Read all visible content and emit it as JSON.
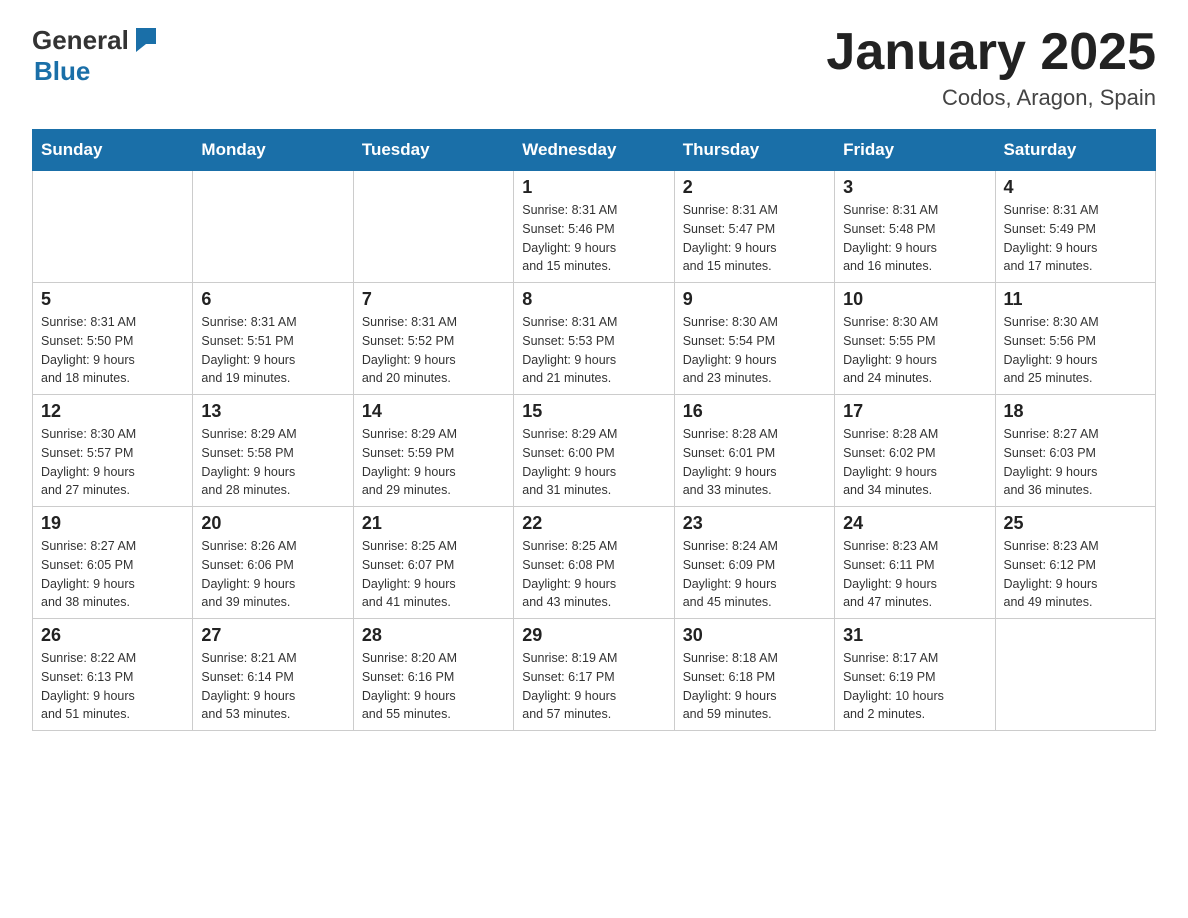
{
  "header": {
    "logo_general": "General",
    "logo_blue": "Blue",
    "title": "January 2025",
    "subtitle": "Codos, Aragon, Spain"
  },
  "days_of_week": [
    "Sunday",
    "Monday",
    "Tuesday",
    "Wednesday",
    "Thursday",
    "Friday",
    "Saturday"
  ],
  "weeks": [
    [
      {
        "day": "",
        "info": ""
      },
      {
        "day": "",
        "info": ""
      },
      {
        "day": "",
        "info": ""
      },
      {
        "day": "1",
        "info": "Sunrise: 8:31 AM\nSunset: 5:46 PM\nDaylight: 9 hours\nand 15 minutes."
      },
      {
        "day": "2",
        "info": "Sunrise: 8:31 AM\nSunset: 5:47 PM\nDaylight: 9 hours\nand 15 minutes."
      },
      {
        "day": "3",
        "info": "Sunrise: 8:31 AM\nSunset: 5:48 PM\nDaylight: 9 hours\nand 16 minutes."
      },
      {
        "day": "4",
        "info": "Sunrise: 8:31 AM\nSunset: 5:49 PM\nDaylight: 9 hours\nand 17 minutes."
      }
    ],
    [
      {
        "day": "5",
        "info": "Sunrise: 8:31 AM\nSunset: 5:50 PM\nDaylight: 9 hours\nand 18 minutes."
      },
      {
        "day": "6",
        "info": "Sunrise: 8:31 AM\nSunset: 5:51 PM\nDaylight: 9 hours\nand 19 minutes."
      },
      {
        "day": "7",
        "info": "Sunrise: 8:31 AM\nSunset: 5:52 PM\nDaylight: 9 hours\nand 20 minutes."
      },
      {
        "day": "8",
        "info": "Sunrise: 8:31 AM\nSunset: 5:53 PM\nDaylight: 9 hours\nand 21 minutes."
      },
      {
        "day": "9",
        "info": "Sunrise: 8:30 AM\nSunset: 5:54 PM\nDaylight: 9 hours\nand 23 minutes."
      },
      {
        "day": "10",
        "info": "Sunrise: 8:30 AM\nSunset: 5:55 PM\nDaylight: 9 hours\nand 24 minutes."
      },
      {
        "day": "11",
        "info": "Sunrise: 8:30 AM\nSunset: 5:56 PM\nDaylight: 9 hours\nand 25 minutes."
      }
    ],
    [
      {
        "day": "12",
        "info": "Sunrise: 8:30 AM\nSunset: 5:57 PM\nDaylight: 9 hours\nand 27 minutes."
      },
      {
        "day": "13",
        "info": "Sunrise: 8:29 AM\nSunset: 5:58 PM\nDaylight: 9 hours\nand 28 minutes."
      },
      {
        "day": "14",
        "info": "Sunrise: 8:29 AM\nSunset: 5:59 PM\nDaylight: 9 hours\nand 29 minutes."
      },
      {
        "day": "15",
        "info": "Sunrise: 8:29 AM\nSunset: 6:00 PM\nDaylight: 9 hours\nand 31 minutes."
      },
      {
        "day": "16",
        "info": "Sunrise: 8:28 AM\nSunset: 6:01 PM\nDaylight: 9 hours\nand 33 minutes."
      },
      {
        "day": "17",
        "info": "Sunrise: 8:28 AM\nSunset: 6:02 PM\nDaylight: 9 hours\nand 34 minutes."
      },
      {
        "day": "18",
        "info": "Sunrise: 8:27 AM\nSunset: 6:03 PM\nDaylight: 9 hours\nand 36 minutes."
      }
    ],
    [
      {
        "day": "19",
        "info": "Sunrise: 8:27 AM\nSunset: 6:05 PM\nDaylight: 9 hours\nand 38 minutes."
      },
      {
        "day": "20",
        "info": "Sunrise: 8:26 AM\nSunset: 6:06 PM\nDaylight: 9 hours\nand 39 minutes."
      },
      {
        "day": "21",
        "info": "Sunrise: 8:25 AM\nSunset: 6:07 PM\nDaylight: 9 hours\nand 41 minutes."
      },
      {
        "day": "22",
        "info": "Sunrise: 8:25 AM\nSunset: 6:08 PM\nDaylight: 9 hours\nand 43 minutes."
      },
      {
        "day": "23",
        "info": "Sunrise: 8:24 AM\nSunset: 6:09 PM\nDaylight: 9 hours\nand 45 minutes."
      },
      {
        "day": "24",
        "info": "Sunrise: 8:23 AM\nSunset: 6:11 PM\nDaylight: 9 hours\nand 47 minutes."
      },
      {
        "day": "25",
        "info": "Sunrise: 8:23 AM\nSunset: 6:12 PM\nDaylight: 9 hours\nand 49 minutes."
      }
    ],
    [
      {
        "day": "26",
        "info": "Sunrise: 8:22 AM\nSunset: 6:13 PM\nDaylight: 9 hours\nand 51 minutes."
      },
      {
        "day": "27",
        "info": "Sunrise: 8:21 AM\nSunset: 6:14 PM\nDaylight: 9 hours\nand 53 minutes."
      },
      {
        "day": "28",
        "info": "Sunrise: 8:20 AM\nSunset: 6:16 PM\nDaylight: 9 hours\nand 55 minutes."
      },
      {
        "day": "29",
        "info": "Sunrise: 8:19 AM\nSunset: 6:17 PM\nDaylight: 9 hours\nand 57 minutes."
      },
      {
        "day": "30",
        "info": "Sunrise: 8:18 AM\nSunset: 6:18 PM\nDaylight: 9 hours\nand 59 minutes."
      },
      {
        "day": "31",
        "info": "Sunrise: 8:17 AM\nSunset: 6:19 PM\nDaylight: 10 hours\nand 2 minutes."
      },
      {
        "day": "",
        "info": ""
      }
    ]
  ]
}
